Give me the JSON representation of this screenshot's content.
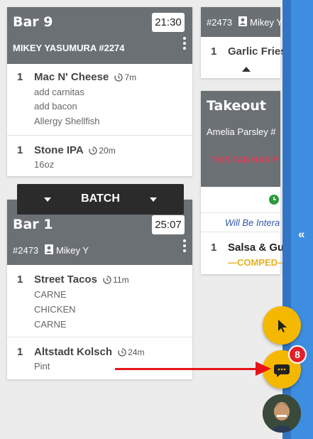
{
  "tickets": {
    "bar9": {
      "title": "Bar 9",
      "timer": "21:30",
      "subtitle": "MIKEY YASUMURA #2274",
      "items": [
        {
          "qty": "1",
          "name": "Mac N' Cheese",
          "age": "7m",
          "mods": [
            "add carnitas",
            "add bacon",
            "Allergy Shellfish"
          ]
        },
        {
          "qty": "1",
          "name": "Stone IPA",
          "age": "20m",
          "mods": [
            "16oz"
          ]
        }
      ]
    },
    "bar1": {
      "title": "Bar 1",
      "timer": "25:07",
      "check": "#2473",
      "server": "Mikey Y",
      "items": [
        {
          "qty": "1",
          "name": "Street Tacos",
          "age": "11m",
          "mods": [
            "CARNE",
            "CHICKEN",
            "CARNE"
          ]
        },
        {
          "qty": "1",
          "name": "Altstadt Kolsch",
          "age": "24m",
          "mods": [
            "Pint"
          ]
        }
      ]
    },
    "right_top": {
      "check": "#2473",
      "server": "Mikey Y",
      "items": [
        {
          "qty": "1",
          "name": "Garlic Fries"
        }
      ]
    },
    "takeout": {
      "title": "Takeout",
      "customer": "Amelia Parsley #",
      "alert": "THIS TAB HAS P",
      "interaction": "Will Be Intera",
      "items": [
        {
          "qty": "1",
          "name": "Salsa & Gu",
          "status": "—COMPED—"
        }
      ]
    }
  },
  "batch": {
    "label": "BATCH"
  },
  "chat": {
    "unread_count": "8"
  },
  "colors": {
    "header": "#6b7075",
    "accent": "#f5b800",
    "sidebar": "#3d8de0",
    "alert": "#d9344a",
    "badge": "#e0202a",
    "annotation": "#e5141a"
  },
  "icons": [
    "timer-icon",
    "user-icon",
    "kebab-menu-icon",
    "chevron-down-icon",
    "chevron-up-icon",
    "clock-icon",
    "double-chevron-left-icon",
    "cursor-icon",
    "chat-icon"
  ]
}
